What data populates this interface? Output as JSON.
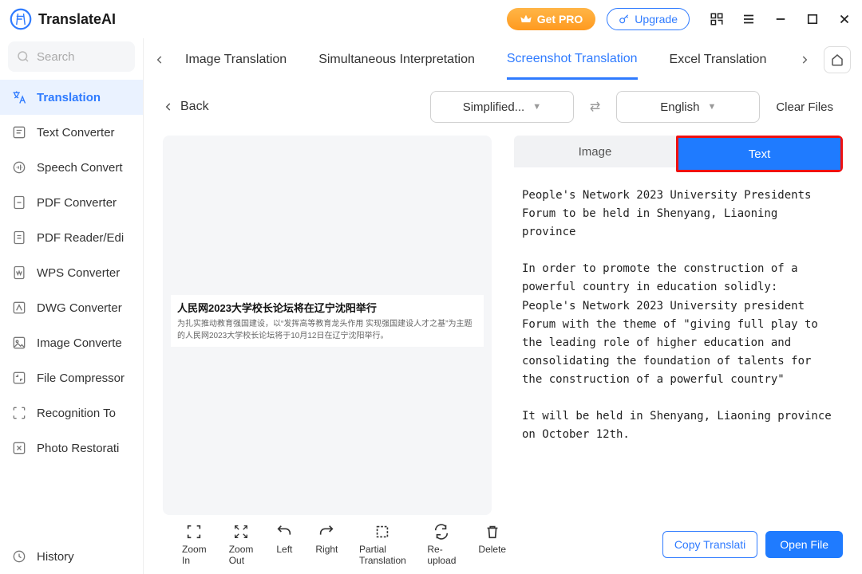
{
  "app": {
    "name": "TranslateAI",
    "getpro": "Get PRO",
    "upgrade": "Upgrade"
  },
  "search": {
    "placeholder": "Search"
  },
  "sidebar": {
    "items": [
      {
        "label": "Translation"
      },
      {
        "label": "Text Converter"
      },
      {
        "label": "Speech Convert"
      },
      {
        "label": "PDF Converter"
      },
      {
        "label": "PDF Reader/Edi"
      },
      {
        "label": "WPS Converter"
      },
      {
        "label": "DWG Converter"
      },
      {
        "label": "Image Converte"
      },
      {
        "label": "File Compressor"
      },
      {
        "label": "Recognition To"
      },
      {
        "label": "Photo Restorati"
      }
    ],
    "history": "History"
  },
  "tabs": [
    {
      "label": "Image Translation"
    },
    {
      "label": "Simultaneous Interpretation"
    },
    {
      "label": "Screenshot Translation"
    },
    {
      "label": "Excel Translation"
    }
  ],
  "back": "Back",
  "langFrom": "Simplified...",
  "langTo": "English",
  "clearFiles": "Clear Files",
  "rightTabs": {
    "image": "Image",
    "text": "Text"
  },
  "source": {
    "title": "人民网2023大学校长论坛将在辽宁沈阳举行",
    "body": "为扎实推动教育强国建设，以“发挥高等教育龙头作用 实现强国建设人才之基”为主题的人民网2023大学校长论坛将于10月12日在辽宁沈阳举行。"
  },
  "result": "People's Network 2023 University Presidents Forum to be held in Shenyang, Liaoning province\n\nIn order to promote the construction of a powerful country in education solidly: People's Network 2023 University president Forum with the theme of \"giving full play to the leading role of higher education and consolidating the foundation of talents for the construction of a powerful country\"\n\nIt will be held in Shenyang, Liaoning province on October 12th.",
  "buttons": {
    "copy": "Copy Translati",
    "open": "Open File"
  },
  "tools": [
    {
      "label": "Zoom In"
    },
    {
      "label": "Zoom Out"
    },
    {
      "label": "Left"
    },
    {
      "label": "Right"
    },
    {
      "label": "Partial Translation"
    },
    {
      "label": "Re-upload"
    },
    {
      "label": "Delete"
    }
  ]
}
